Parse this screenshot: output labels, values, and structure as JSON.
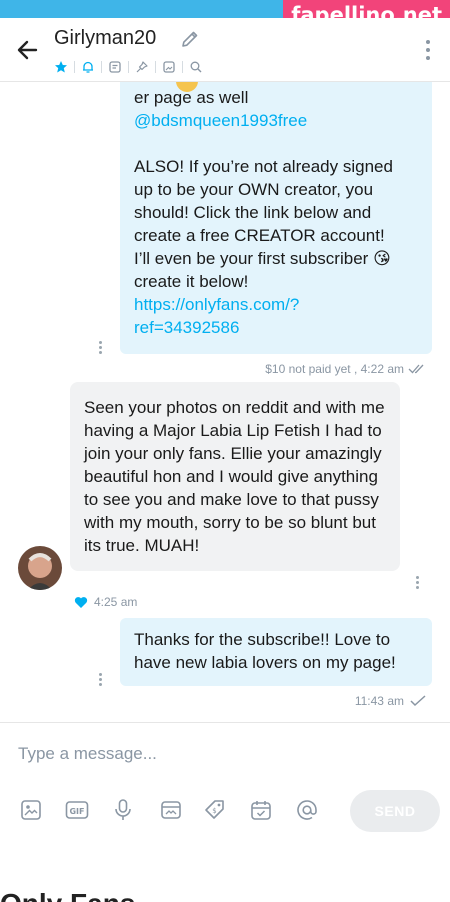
{
  "watermark": "fapellino.net",
  "header": {
    "title": "Girlyman20"
  },
  "messages": {
    "outgoing_1": {
      "lines": [
        "er page as well",
        "@bdsmqueen1993free",
        "",
        "ALSO! If you’re not already signed",
        "up to be your OWN creator, you",
        "should! Click the link below and",
        "create a free CREATOR account!",
        "I’ll even be your first subscriber",
        "create it below!",
        "https://onlyfans.com/?",
        "ref=34392586"
      ],
      "emoji": "😘",
      "meta": "$10 not paid yet ,  4:22 am"
    },
    "incoming_1": {
      "text": "Seen your photos on reddit and with me having a Major Labia Lip Fetish I had to join your only fans. Ellie your amazingly beautiful hon and I would give anything to see you and make love to that pussy with my mouth, sorry to be so blunt but its true. MUAH!",
      "time": "4:25 am"
    },
    "outgoing_2": {
      "text": "Thanks for the subscribe!! Love to have new labia lovers on my page!",
      "meta": "11:43 am"
    }
  },
  "composer": {
    "placeholder": "Type a message...",
    "send_label": "SEND"
  },
  "icons": {
    "back": "arrow-left-icon",
    "edit": "pencil-icon",
    "menu": "more-vertical-icon",
    "sub": [
      "star-icon",
      "bell-icon",
      "note-icon",
      "pin-icon",
      "media-icon",
      "search-icon"
    ],
    "tools": [
      "image-icon",
      "gif-icon",
      "microphone-icon",
      "media-vault-icon",
      "price-tag-icon",
      "calendar-icon",
      "mention-icon"
    ]
  },
  "colors": {
    "accent": "#00aff0",
    "out_bubble": "#e3f4fc",
    "in_bubble": "#f1f2f3",
    "watermark": "#f2447a"
  },
  "bottom_partial_text": "Only Fans ... "
}
